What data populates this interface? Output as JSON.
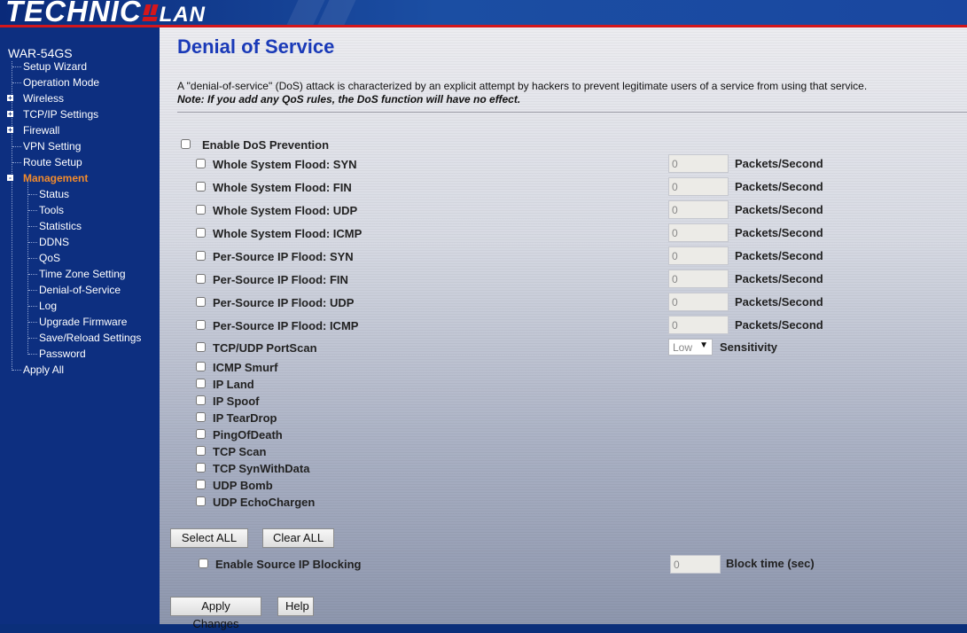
{
  "brand": {
    "logo_main": "TECHNIC",
    "logo_sub": "LAN"
  },
  "sidebar": {
    "device": "WAR-54GS",
    "items": [
      {
        "label": "Setup Wizard"
      },
      {
        "label": "Operation Mode"
      },
      {
        "label": "Wireless"
      },
      {
        "label": "TCP/IP Settings"
      },
      {
        "label": "Firewall"
      },
      {
        "label": "VPN Setting"
      },
      {
        "label": "Route Setup"
      },
      {
        "label": "Management"
      },
      {
        "label": "Status"
      },
      {
        "label": "Tools"
      },
      {
        "label": "Statistics"
      },
      {
        "label": "DDNS"
      },
      {
        "label": "QoS"
      },
      {
        "label": "Time Zone Setting"
      },
      {
        "label": "Denial-of-Service"
      },
      {
        "label": "Log"
      },
      {
        "label": "Upgrade Firmware"
      },
      {
        "label": "Save/Reload Settings"
      },
      {
        "label": "Password"
      },
      {
        "label": "Apply All"
      }
    ],
    "expand_plus": "+",
    "expand_minus": "-"
  },
  "main": {
    "title": "Denial of Service",
    "description": "A \"denial-of-service\" (DoS) attack is characterized by an explicit attempt by hackers to prevent legitimate users of a service from using that service.",
    "note": "Note: If you add any QoS rules, the DoS function will have no effect.",
    "enable_dos": "Enable DoS Prevention",
    "floods": [
      {
        "label": "Whole System Flood: SYN",
        "value": "0",
        "unit": "Packets/Second"
      },
      {
        "label": "Whole System Flood: FIN",
        "value": "0",
        "unit": "Packets/Second"
      },
      {
        "label": "Whole System Flood: UDP",
        "value": "0",
        "unit": "Packets/Second"
      },
      {
        "label": "Whole System Flood: ICMP",
        "value": "0",
        "unit": "Packets/Second"
      },
      {
        "label": "Per-Source IP Flood: SYN",
        "value": "0",
        "unit": "Packets/Second"
      },
      {
        "label": "Per-Source IP Flood: FIN",
        "value": "0",
        "unit": "Packets/Second"
      },
      {
        "label": "Per-Source IP Flood: UDP",
        "value": "0",
        "unit": "Packets/Second"
      },
      {
        "label": "Per-Source IP Flood: ICMP",
        "value": "0",
        "unit": "Packets/Second"
      }
    ],
    "portscan": {
      "label": "TCP/UDP PortScan",
      "selected": "Low",
      "arrow": "▼",
      "unit": "Sensitivity"
    },
    "attacks": [
      {
        "label": "ICMP Smurf"
      },
      {
        "label": "IP Land"
      },
      {
        "label": "IP Spoof"
      },
      {
        "label": "IP TearDrop"
      },
      {
        "label": "PingOfDeath"
      },
      {
        "label": "TCP Scan"
      },
      {
        "label": "TCP SynWithData"
      },
      {
        "label": "UDP Bomb"
      },
      {
        "label": "UDP EchoChargen"
      }
    ],
    "select_all": "Select ALL",
    "clear_all": "Clear ALL",
    "source_block": {
      "label": "Enable Source IP Blocking",
      "value": "0",
      "unit": "Block time (sec)"
    },
    "apply": "Apply Changes",
    "help": "Help"
  }
}
